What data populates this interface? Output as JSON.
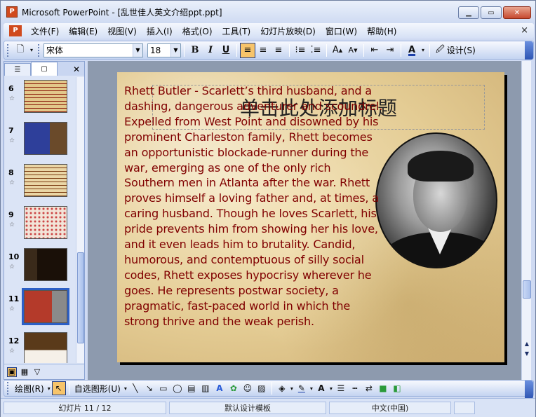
{
  "app": {
    "icon_text": "P",
    "title": "Microsoft PowerPoint - [乱世佳人英文介绍ppt.ppt]"
  },
  "menu": {
    "icon_text": "P",
    "items": [
      "文件(F)",
      "编辑(E)",
      "视图(V)",
      "插入(I)",
      "格式(O)",
      "工具(T)",
      "幻灯片放映(D)",
      "窗口(W)",
      "帮助(H)"
    ],
    "close": "×"
  },
  "toolbar": {
    "font_name": "宋体",
    "font_size": "18",
    "bold": "B",
    "italic": "I",
    "underline": "U",
    "design_label": "设计(S)"
  },
  "thumbnails": [
    {
      "num": "6"
    },
    {
      "num": "7"
    },
    {
      "num": "8"
    },
    {
      "num": "9"
    },
    {
      "num": "10"
    },
    {
      "num": "11",
      "selected": true
    },
    {
      "num": "12"
    }
  ],
  "slide": {
    "placeholder": "单击此处添加标题",
    "body": "Rhett Butler  - Scarlett’s third husband, and a dashing, dangerous adventurer and scoundrel. Expelled from West Point and disowned by his prominent Charleston family, Rhett becomes an opportunistic blockade-runner during the war, emerging as one of the only rich Southern men in Atlanta after the war. Rhett proves himself a loving father and, at times, a caring husband. Though he loves Scarlett, his pride prevents him from showing her his love, and it even leads him to brutality. Candid, humorous, and contemptuous of silly social codes, Rhett exposes hypocrisy wherever he goes. He represents postwar society, a pragmatic, fast-paced world in which the strong thrive and the weak perish."
  },
  "drawbar": {
    "draw_label": "绘图(R)",
    "autoshape_label": "自选图形(U)"
  },
  "status": {
    "slide_pos": "幻灯片 11 / 12",
    "template": "默认设计模板",
    "language": "中文(中国)"
  },
  "colors": {
    "accent": "#2c5fc5",
    "body_text": "#800000"
  }
}
